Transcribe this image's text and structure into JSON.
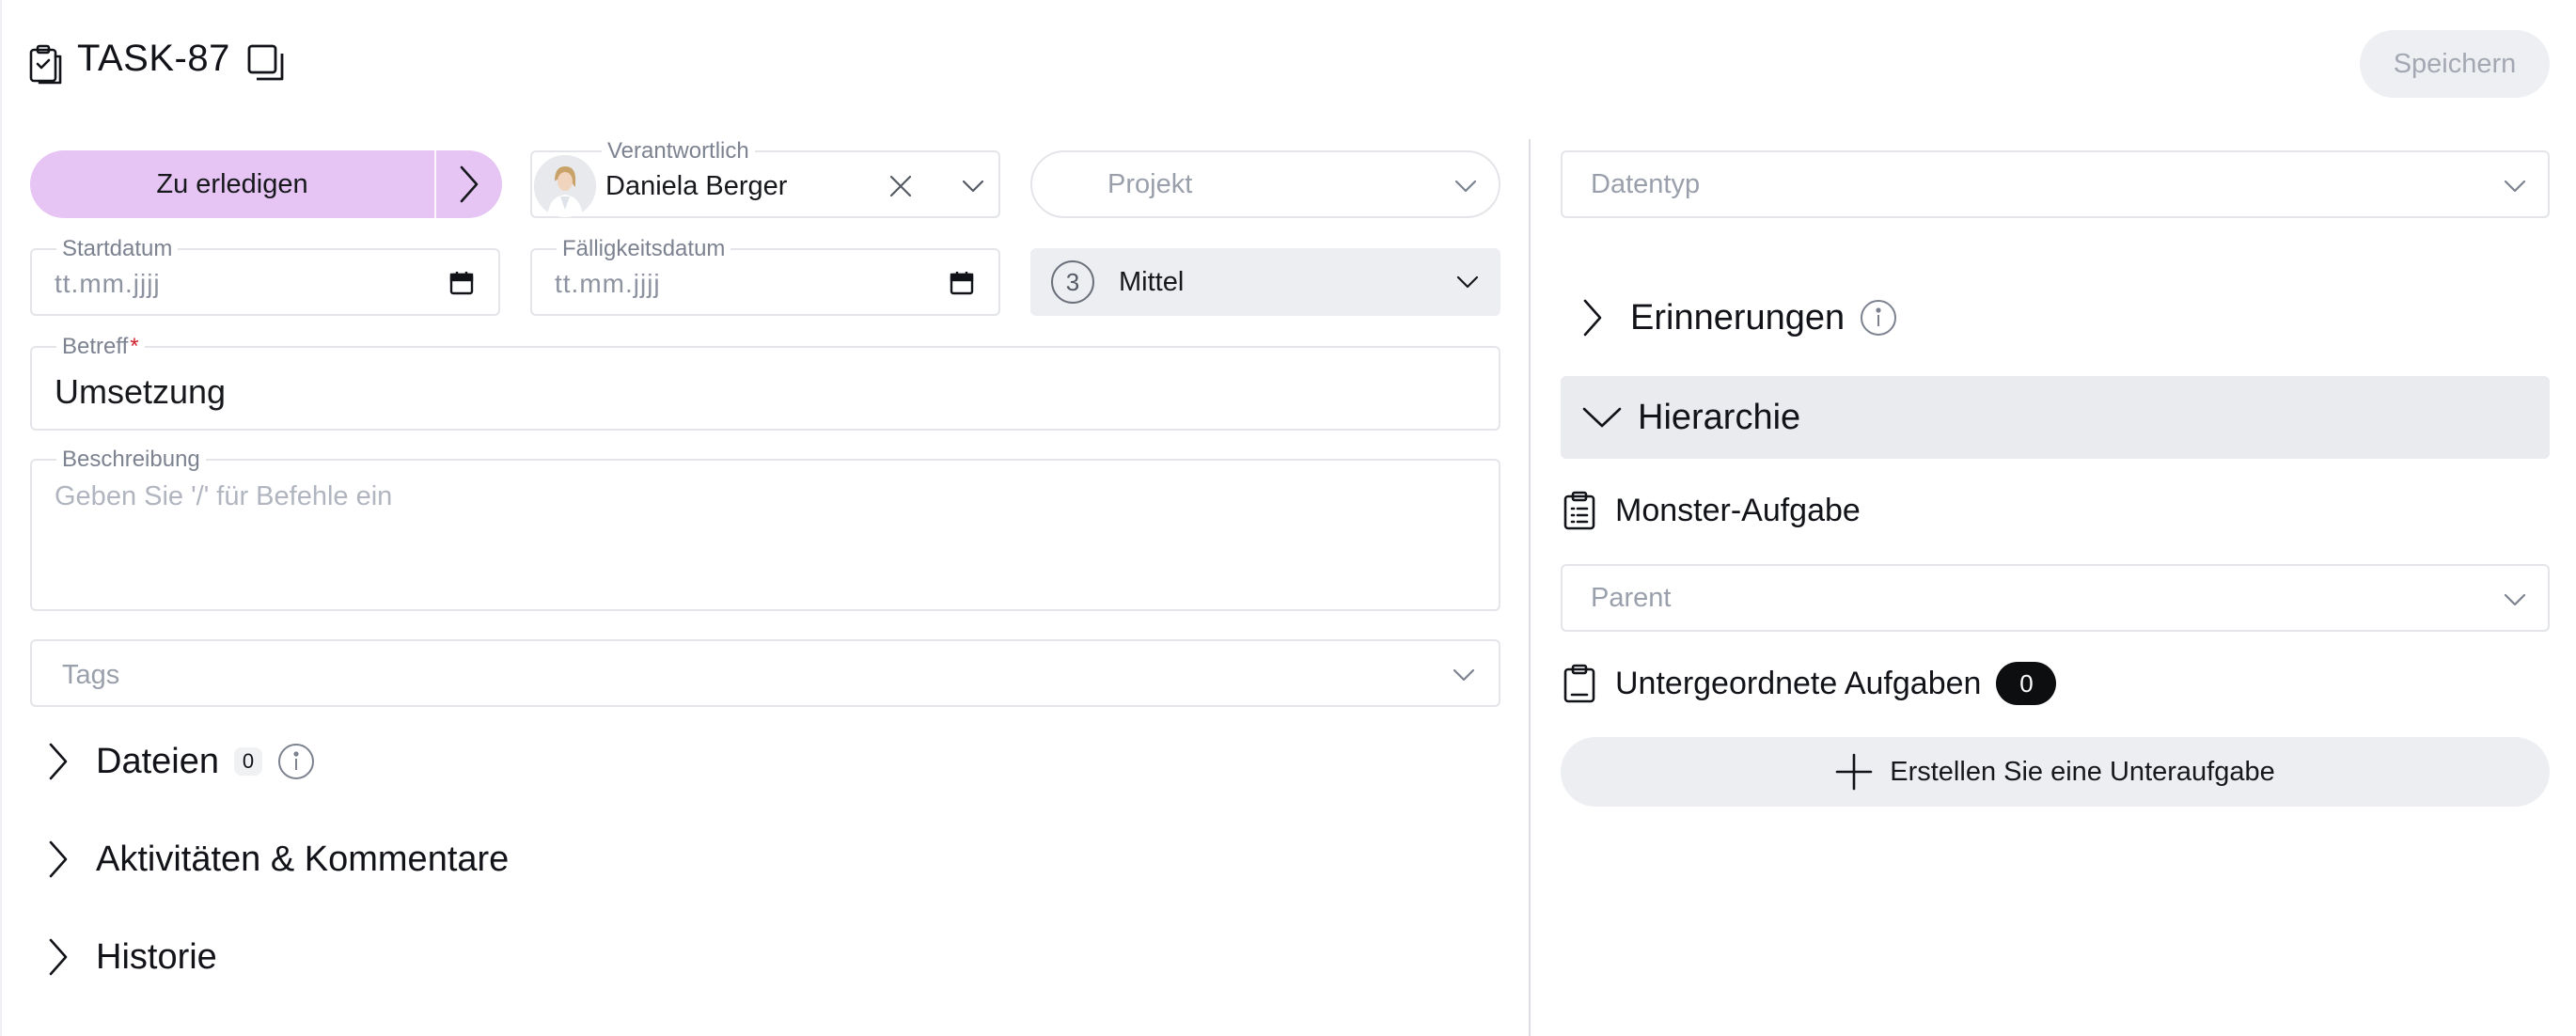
{
  "header": {
    "task_id": "TASK-87",
    "save_label": "Speichern",
    "task_icon": "clipboard-task-icon",
    "copy_icon": "copy-icon"
  },
  "status": {
    "label": "Zu erledigen",
    "next_icon": "chevron-right-icon",
    "color": "#e6c5f4"
  },
  "assignee": {
    "label": "Verantwortlich",
    "value": "Daniela Berger",
    "clear_icon": "close-icon",
    "dropdown_icon": "chevron-down-icon"
  },
  "project": {
    "placeholder": "Projekt"
  },
  "start_date": {
    "label": "Startdatum",
    "placeholder": "tt.mm.jjjj",
    "icon": "calendar-icon"
  },
  "due_date": {
    "label": "Fälligkeitsdatum",
    "placeholder": "tt.mm.jjjj",
    "icon": "calendar-icon"
  },
  "priority": {
    "level": "3",
    "value": "Mittel"
  },
  "subject": {
    "label": "Betreff",
    "required_mark": "*",
    "value": "Umsetzung"
  },
  "description": {
    "label": "Beschreibung",
    "placeholder": "Geben Sie '/' für Befehle ein"
  },
  "tags": {
    "placeholder": "Tags"
  },
  "sections": {
    "files": {
      "title": "Dateien",
      "count": "0"
    },
    "activities": {
      "title": "Aktivitäten & Kommentare"
    },
    "history": {
      "title": "Historie"
    }
  },
  "right": {
    "datatype_placeholder": "Datentyp",
    "reminders_title": "Erinnerungen",
    "hierarchy_title": "Hierarchie",
    "parent_task_label": "Monster-Aufgabe",
    "parent_placeholder": "Parent",
    "subtasks_label": "Untergeordnete Aufgaben",
    "subtasks_count": "0",
    "create_subtask_label": "Erstellen Sie eine Unteraufgabe"
  }
}
